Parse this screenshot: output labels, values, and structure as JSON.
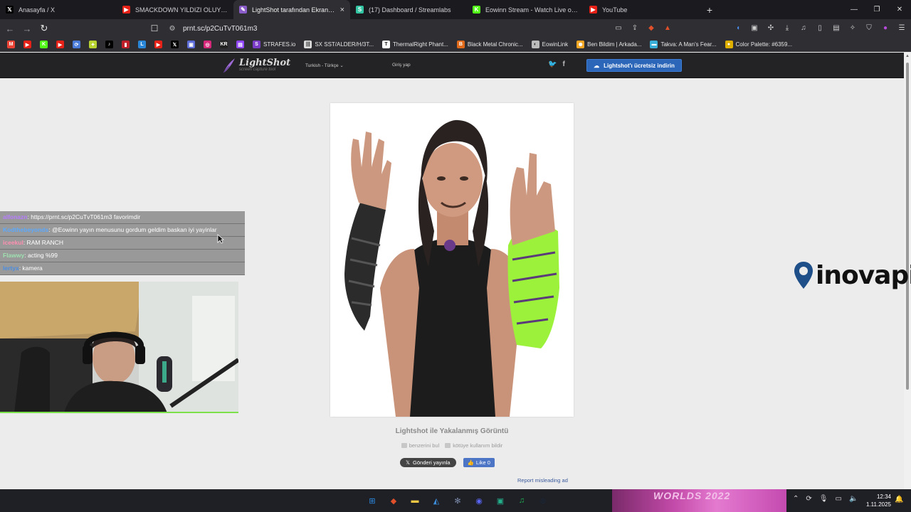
{
  "browser": {
    "tabs": [
      {
        "title": "Anasayfa / X",
        "icon": "x-icon",
        "color": "#000000",
        "glyph": "𝕏",
        "active": false,
        "closable": false
      },
      {
        "title": "SMACKDOWN YILDIZI OLUYORUM",
        "icon": "youtube-icon",
        "color": "#e62117",
        "glyph": "▶",
        "active": false,
        "closable": false
      },
      {
        "title": "LightShot tarafından Ekran Görü",
        "icon": "lightshot-icon",
        "color": "#8a5cc7",
        "glyph": "✎",
        "active": true,
        "closable": true
      },
      {
        "title": "(17) Dashboard / Streamlabs",
        "icon": "streamlabs-icon",
        "color": "#31c3a2",
        "glyph": "S",
        "active": false,
        "closable": false
      },
      {
        "title": "Eowinn Stream - Watch Live on Kick",
        "icon": "kick-icon",
        "color": "#53fc18",
        "glyph": "K",
        "active": false,
        "closable": false
      },
      {
        "title": "YouTube",
        "icon": "youtube-icon",
        "color": "#e62117",
        "glyph": "▶",
        "active": false,
        "closable": false
      }
    ],
    "close_glyph": "×",
    "new_tab_glyph": "+",
    "window_controls": {
      "minimize": "—",
      "maximize": "❐",
      "close": "✕"
    },
    "nav": {
      "back": "←",
      "forward": "→",
      "reload": "↻",
      "bookmark": "☐",
      "site_settings": "⚙"
    },
    "address": {
      "url": "prnt.sc/p2CuTvT061m3"
    },
    "bookmarks": [
      {
        "label": "",
        "icon": "gmail-icon",
        "color": "#ea4335",
        "glyph": "M"
      },
      {
        "label": "",
        "icon": "youtube-icon",
        "color": "#e62117",
        "glyph": "▶"
      },
      {
        "label": "",
        "icon": "kick-icon",
        "color": "#53fc18",
        "glyph": "K"
      },
      {
        "label": "",
        "icon": "youtube-icon",
        "color": "#e62117",
        "glyph": "▶"
      },
      {
        "label": "",
        "icon": "sync-icon",
        "color": "#4a7bd9",
        "glyph": "⟳"
      },
      {
        "label": "",
        "icon": "game-icon",
        "color": "#b8d430",
        "glyph": "✦"
      },
      {
        "label": "",
        "icon": "tiktok-icon",
        "color": "#000000",
        "glyph": "♪"
      },
      {
        "label": "",
        "icon": "bookmark-red-icon",
        "color": "#c0202a",
        "glyph": "▮"
      },
      {
        "label": "",
        "icon": "letter-l-icon",
        "color": "#2a86d6",
        "glyph": "L"
      },
      {
        "label": "",
        "icon": "youtube-icon",
        "color": "#e62117",
        "glyph": "▶"
      },
      {
        "label": "",
        "icon": "x-icon",
        "color": "#000000",
        "glyph": "𝕏"
      },
      {
        "label": "",
        "icon": "app-icon",
        "color": "#5b6cd8",
        "glyph": "▣"
      },
      {
        "label": "",
        "icon": "instagram-icon",
        "color": "#d6287a",
        "glyph": "◎"
      },
      {
        "label": "",
        "icon": "kr-icon",
        "color": "#222222",
        "glyph": "KR"
      },
      {
        "label": "",
        "icon": "twitch-icon",
        "color": "#9146ff",
        "glyph": "▤"
      },
      {
        "label": "STRAFES.io",
        "icon": "strafes-icon",
        "color": "#7a3cc8",
        "glyph": "S"
      },
      {
        "label": "SX SST/ALDER/H/3T...",
        "icon": "bars-icon",
        "color": "#dddddd",
        "glyph": "|||"
      },
      {
        "label": "ThermalRight Phant...",
        "icon": "thermal-icon",
        "color": "#ffffff",
        "glyph": "T"
      },
      {
        "label": "Black Metal Chronic...",
        "icon": "bm-icon",
        "color": "#e06a1a",
        "glyph": "B"
      },
      {
        "label": "EowinLink",
        "icon": "link-icon",
        "color": "#bbbbbb",
        "glyph": "◐"
      },
      {
        "label": "Ben Bildim | Arkada...",
        "icon": "bell-icon",
        "color": "#f2a623",
        "glyph": "✺"
      },
      {
        "label": "Takva: A Man's Fear...",
        "icon": "flag-icon",
        "color": "#3ab0d8",
        "glyph": "▬"
      },
      {
        "label": "Color Palette: #6359...",
        "icon": "palette-icon",
        "color": "#e0b000",
        "glyph": "●"
      }
    ]
  },
  "lightshot": {
    "logo_name": "LightShot",
    "logo_sub": "screen capture tool",
    "language": "Turkish - Türkçe",
    "login": "Giriş yap",
    "download_button": "Lightshot'ı ücretsiz indirin",
    "caption": "Lightshot ile Yakalanmış Görüntü",
    "find_similar": "benzerini bul",
    "report_abuse": "kötüye kullanım bildir",
    "share_x": "Gönderi yayınla",
    "fb_like": "Like 0",
    "report_ad": "Report misleading ad",
    "ad_brand": "inovapin",
    "accent": "#2b66b8"
  },
  "chat": {
    "messages": [
      {
        "user": "alfonazn",
        "user_color": "#b67cff",
        "text": ": https://prnt.sc/p2CuTvT061m3 favorimdir"
      },
      {
        "user": "Kodthebeyonds",
        "user_color": "#5aa9ff",
        "text": ": @Eowinn yayın menusunu gordum geldim baskan iyi yayinlar"
      },
      {
        "user": "iceekul",
        "user_color": "#ff8fb1",
        "text": ": RAM RANCH"
      },
      {
        "user": "Flawwy",
        "user_color": "#9ee0b0",
        "text": ": acting %99"
      },
      {
        "user": "lertyx",
        "user_color": "#4b8de0",
        "text": ": kamera"
      }
    ]
  },
  "taskbar": {
    "art_text": "WORLDS 2022",
    "apps": [
      {
        "icon": "windows-start-icon",
        "color": "#2b8ce6",
        "glyph": "⊞"
      },
      {
        "icon": "brave-icon",
        "color": "#e0502a",
        "glyph": "◆"
      },
      {
        "icon": "folder-icon",
        "color": "#f2c744",
        "glyph": "▬"
      },
      {
        "icon": "store-icon",
        "color": "#3c8cd8",
        "glyph": "◭"
      },
      {
        "icon": "settings-app-icon",
        "color": "#7a8aa8",
        "glyph": "✻"
      },
      {
        "icon": "discord-icon",
        "color": "#5865f2",
        "glyph": "◉"
      },
      {
        "icon": "app-green-icon",
        "color": "#23b08a",
        "glyph": "▣"
      },
      {
        "icon": "spotify-icon",
        "color": "#1db954",
        "glyph": "♫"
      },
      {
        "icon": "steam-icon",
        "color": "#1b2838",
        "glyph": "⊛"
      }
    ],
    "tray": [
      {
        "icon": "chevron-up-icon",
        "glyph": "⌃"
      },
      {
        "icon": "sync-tray-icon",
        "glyph": "⟳"
      },
      {
        "icon": "mic-icon",
        "glyph": "🎙"
      },
      {
        "icon": "network-icon",
        "glyph": "▭"
      },
      {
        "icon": "volume-icon",
        "glyph": "🔈"
      }
    ],
    "time": "12:34",
    "date": "1.11.2025",
    "notification_glyph": "🔔"
  }
}
